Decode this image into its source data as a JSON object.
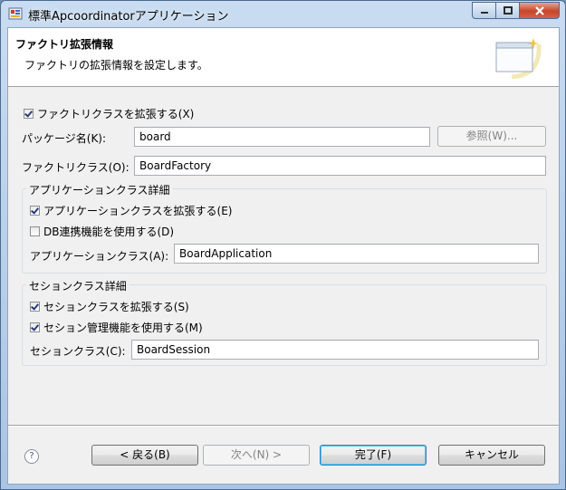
{
  "window": {
    "title": "標準Apcoordinatorアプリケーション"
  },
  "header": {
    "title": "ファクトリ拡張情報",
    "description": "ファクトリの拡張情報を設定します。"
  },
  "factory": {
    "extend_label": "ファクトリクラスを拡張する(X)",
    "extend_checked": true,
    "package_label": "パッケージ名(K):",
    "package_value": "board",
    "browse_label": "参照(W)...",
    "class_label": "ファクトリクラス(O):",
    "class_value": "BoardFactory"
  },
  "app_group": {
    "title": "アプリケーションクラス詳細",
    "extend_label": "アプリケーションクラスを拡張する(E)",
    "extend_checked": true,
    "db_label": "DB連携機能を使用する(D)",
    "db_checked": false,
    "class_label": "アプリケーションクラス(A):",
    "class_value": "BoardApplication"
  },
  "session_group": {
    "title": "セションクラス詳細",
    "extend_label": "セションクラスを拡張する(S)",
    "extend_checked": true,
    "manage_label": "セション管理機能を使用する(M)",
    "manage_checked": true,
    "class_label": "セションクラス(C):",
    "class_value": "BoardSession"
  },
  "buttons": {
    "help": "?",
    "back": "< 戻る(B)",
    "next": "次へ(N) >",
    "finish": "完了(F)",
    "cancel": "キャンセル"
  },
  "colors": {
    "title_bar": "#b9d1ea",
    "close_button": "#c7452a",
    "dialog_bg": "#f0f0f0"
  }
}
